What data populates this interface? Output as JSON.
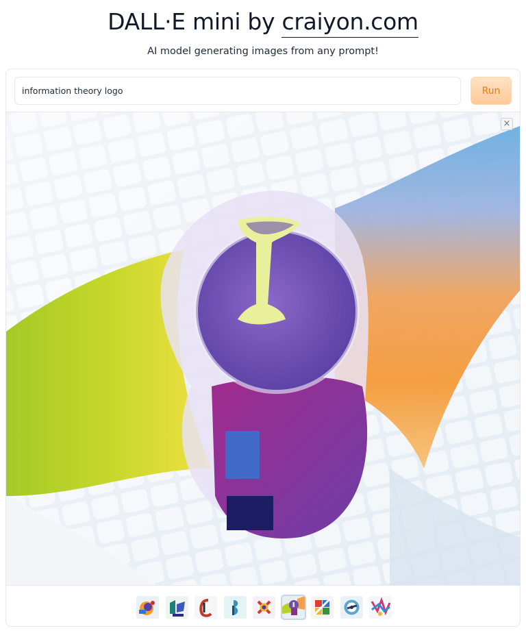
{
  "header": {
    "title_prefix": "DALL·E mini by",
    "title_link": "craiyon.com",
    "subtitle": "AI model generating images from any prompt!"
  },
  "prompt": {
    "value": "information theory logo",
    "placeholder": ""
  },
  "run_button": {
    "label": "Run",
    "color": "#f07a18"
  },
  "gallery": {
    "close_label": "×",
    "selected_index": 5,
    "thumbnails": [
      {
        "name": "thumbnail-1"
      },
      {
        "name": "thumbnail-2"
      },
      {
        "name": "thumbnail-3"
      },
      {
        "name": "thumbnail-4"
      },
      {
        "name": "thumbnail-5"
      },
      {
        "name": "thumbnail-6"
      },
      {
        "name": "thumbnail-7"
      },
      {
        "name": "thumbnail-8"
      },
      {
        "name": "thumbnail-9"
      }
    ]
  }
}
